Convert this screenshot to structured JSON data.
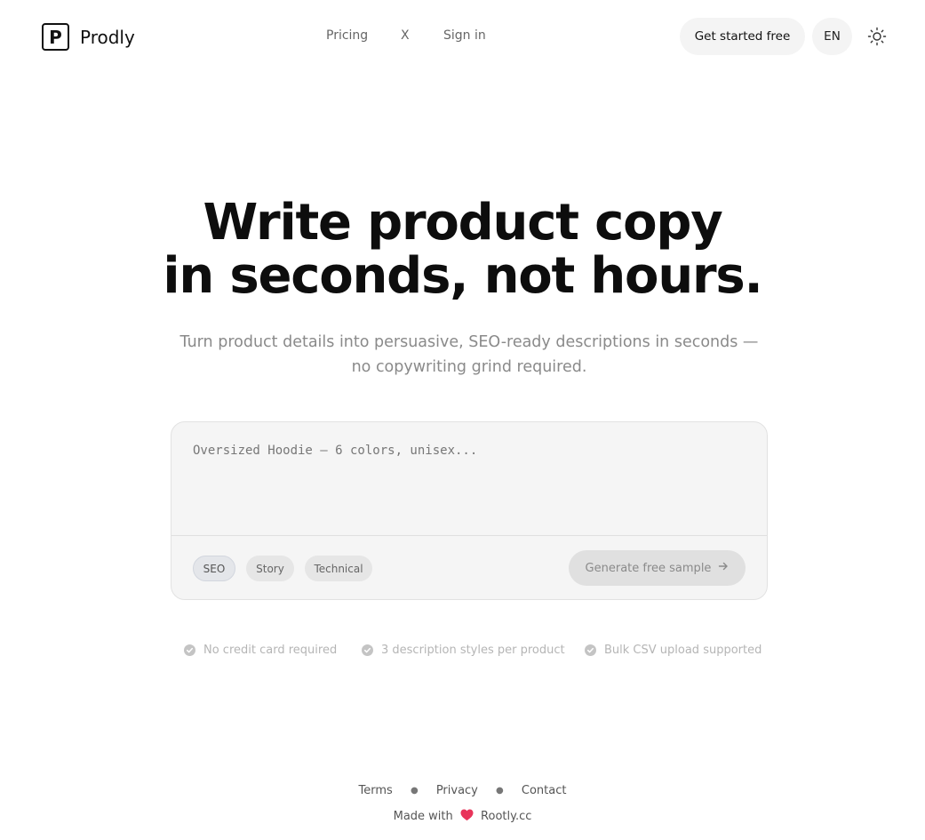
{
  "header": {
    "logo_letter": "P",
    "brand": "Prodly",
    "nav": {
      "pricing": "Pricing",
      "x": "X",
      "sign_in": "Sign in"
    },
    "cta_label": "Get started free",
    "language": "EN",
    "theme_icon": "sun-icon"
  },
  "hero": {
    "title_line1": "Write product copy",
    "title_line2": "in seconds, not hours.",
    "subtitle": "Turn product details into persuasive, SEO-ready descriptions in seconds — no copywriting grind required."
  },
  "generator": {
    "input_placeholder": "Oversized Hoodie — 6 colors, unisex...",
    "input_value": "",
    "styles": [
      "SEO",
      "Story",
      "Technical"
    ],
    "selected_style": "SEO",
    "generate_label": "Generate free sample",
    "generate_icon": "arrow-right-icon"
  },
  "features": [
    "No credit card required",
    "3 description styles per product",
    "Bulk CSV upload supported"
  ],
  "footer": {
    "links": [
      "Terms",
      "Privacy",
      "Contact"
    ],
    "made_with_prefix": "Made with",
    "made_with_icon": "heart-icon",
    "made_with_site": "Rootly.cc"
  },
  "colors": {
    "accent_heart": "#e8345a",
    "text_primary": "#111111",
    "text_muted": "#8a8a8a"
  }
}
